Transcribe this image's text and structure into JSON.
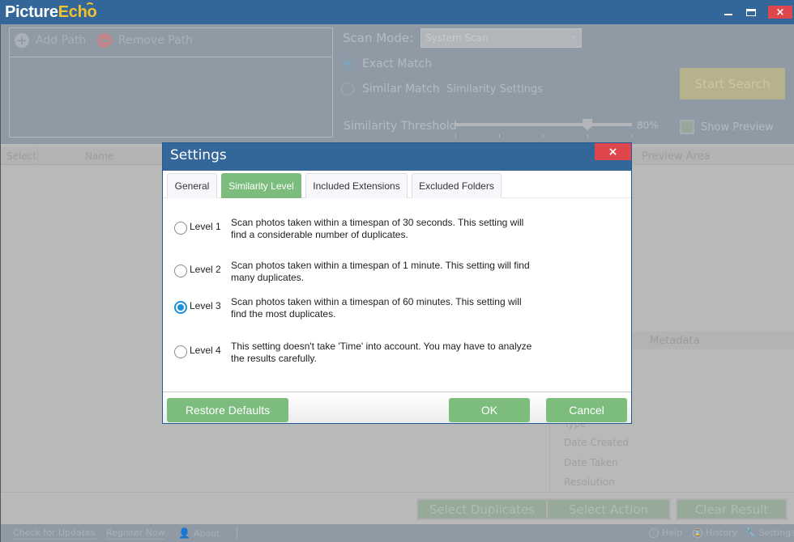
{
  "app": {
    "logo_part1": "Picture",
    "logo_part2": "Echo",
    "window_controls": {
      "minimize": "minimize",
      "maximize": "maximize",
      "close": "×"
    }
  },
  "paths": {
    "add_label": "Add Path",
    "remove_label": "Remove Path"
  },
  "scan": {
    "mode_label": "Scan Mode:",
    "mode_value": "System Scan",
    "exact_match": "Exact Match",
    "similar_match": "Similar Match",
    "similarity_settings": "Similarity Settings",
    "start_search": "Start Search",
    "threshold_label": "Similarity Threshold",
    "threshold_value": "80%",
    "threshold_percent": 80,
    "show_preview": "Show Preview",
    "selected_mode": "exact"
  },
  "results": {
    "columns": [
      "Select",
      "Name"
    ],
    "preview_area": "Preview Area",
    "metadata_label": "Metadata",
    "metadata_fields": [
      "Type",
      "Date Created",
      "Date Taken",
      "Resolution"
    ],
    "actions": [
      "Select Duplicates",
      "Select Action",
      "Clear Result"
    ]
  },
  "statusbar": {
    "check_updates": "Check for Updates",
    "register": "Register Now",
    "about": "About",
    "help": "Help",
    "history": "History",
    "settings": "Settings"
  },
  "dialog": {
    "title": "Settings",
    "close": "×",
    "tabs": [
      "General",
      "Similarity Level",
      "Included Extensions",
      "Excluded Folders"
    ],
    "active_tab": "Similarity Level",
    "levels": [
      {
        "name": "Level 1",
        "desc": "Scan photos taken within a timespan of 30 seconds. This setting will find a considerable number of duplicates.",
        "selected": false
      },
      {
        "name": "Level 2",
        "desc": "Scan photos taken within a timespan of 1 minute. This setting will find many duplicates.",
        "selected": false
      },
      {
        "name": "Level 3",
        "desc": "Scan photos taken within a timespan of 60 minutes. This setting will find the most duplicates.",
        "selected": true
      },
      {
        "name": "Level 4",
        "desc": "This setting doesn't take 'Time' into account. You may have to analyze the results carefully.",
        "selected": false
      }
    ],
    "restore_defaults": "Restore Defaults",
    "ok": "OK",
    "cancel": "Cancel"
  }
}
